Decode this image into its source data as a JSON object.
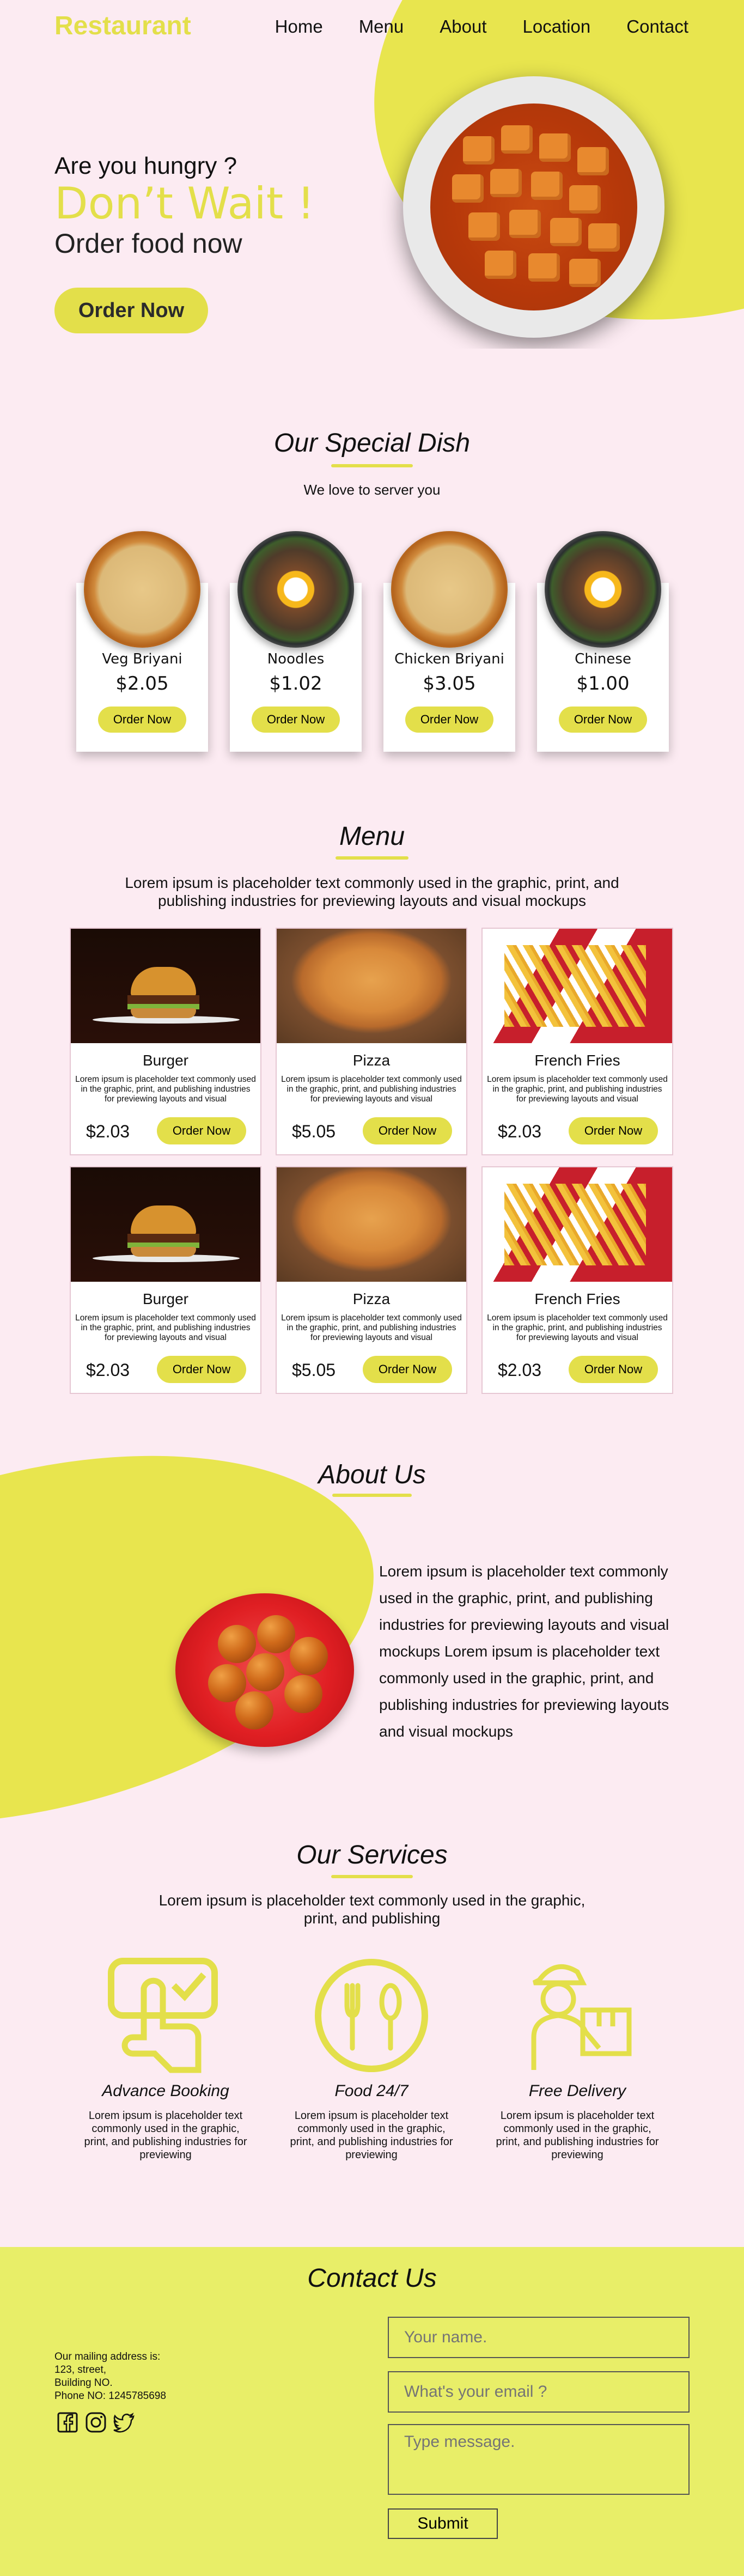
{
  "header": {
    "logo": "Restaurant",
    "nav": [
      "Home",
      "Menu",
      "About",
      "Location",
      "Contact"
    ]
  },
  "hero": {
    "question": "Are you hungry ?",
    "headline": "Don’t Wait !",
    "subline": "Order food now",
    "cta": "Order Now"
  },
  "special": {
    "title": "Our Special Dish",
    "subtitle": "We love to server you",
    "items": [
      {
        "name": "Veg Briyani",
        "price": "$2.05",
        "button": "Order Now"
      },
      {
        "name": "Noodles",
        "price": "$1.02",
        "button": "Order Now"
      },
      {
        "name": "Chicken Briyani",
        "price": "$3.05",
        "button": "Order Now"
      },
      {
        "name": "Chinese",
        "price": "$1.00",
        "button": "Order Now"
      }
    ]
  },
  "menu": {
    "title": "Menu",
    "subtitle": "Lorem ipsum is placeholder text commonly used in the graphic, print, and publishing industries for previewing layouts and visual mockups",
    "items": [
      {
        "name": "Burger",
        "desc": "Lorem ipsum is placeholder text commonly used in the graphic, print, and publishing industries for previewing layouts and visual",
        "price": "$2.03",
        "button": "Order Now"
      },
      {
        "name": "Pizza",
        "desc": "Lorem ipsum is placeholder text commonly used in the graphic, print, and publishing industries for previewing layouts and visual",
        "price": "$5.05",
        "button": "Order Now"
      },
      {
        "name": "French Fries",
        "desc": "Lorem ipsum is placeholder text commonly used in the graphic, print, and publishing industries for previewing layouts and visual",
        "price": "$2.03",
        "button": "Order Now"
      },
      {
        "name": "Burger",
        "desc": "Lorem ipsum is placeholder text commonly used in the graphic, print, and publishing industries for previewing layouts and visual",
        "price": "$2.03",
        "button": "Order Now"
      },
      {
        "name": "Pizza",
        "desc": "Lorem ipsum is placeholder text commonly used in the graphic, print, and publishing industries for previewing layouts and visual",
        "price": "$5.05",
        "button": "Order Now"
      },
      {
        "name": "French Fries",
        "desc": "Lorem ipsum is placeholder text commonly used in the graphic, print, and publishing industries for previewing layouts and visual",
        "price": "$2.03",
        "button": "Order Now"
      }
    ]
  },
  "about": {
    "title": "About Us",
    "text": "Lorem ipsum is placeholder text commonly used in the graphic, print, and publishing industries for previewing layouts and visual mockups Lorem ipsum is placeholder text commonly used in the graphic, print, and publishing industries for previewing layouts and visual mockups"
  },
  "services": {
    "title": "Our Services",
    "subtitle": "Lorem ipsum is placeholder text commonly used in the graphic, print, and publishing",
    "items": [
      {
        "title": "Advance Booking",
        "desc": "Lorem ipsum is placeholder text commonly used in the graphic, print, and publishing industries for previewing",
        "icon": "booking-icon"
      },
      {
        "title": "Food 24/7",
        "desc": "Lorem ipsum is placeholder text commonly used in the graphic, print, and publishing industries for previewing",
        "icon": "cutlery-icon"
      },
      {
        "title": "Free Delivery",
        "desc": "Lorem ipsum is placeholder text commonly used in the graphic, print, and publishing industries for previewing",
        "icon": "delivery-icon"
      }
    ]
  },
  "contact": {
    "title": "Contact Us",
    "address_lines": [
      "Our mailing address is:",
      "123, street,",
      "Building NO.",
      "Phone NO: 1245785698"
    ],
    "name_placeholder": "Your name.",
    "email_placeholder": "What's your email ?",
    "message_placeholder": "Type message.",
    "submit": "Submit",
    "socials": [
      "facebook-icon",
      "instagram-icon",
      "twitter-icon"
    ]
  },
  "colors": {
    "accent": "#e3df4a",
    "background": "#fcebf2",
    "footer": "#e8ee68"
  }
}
